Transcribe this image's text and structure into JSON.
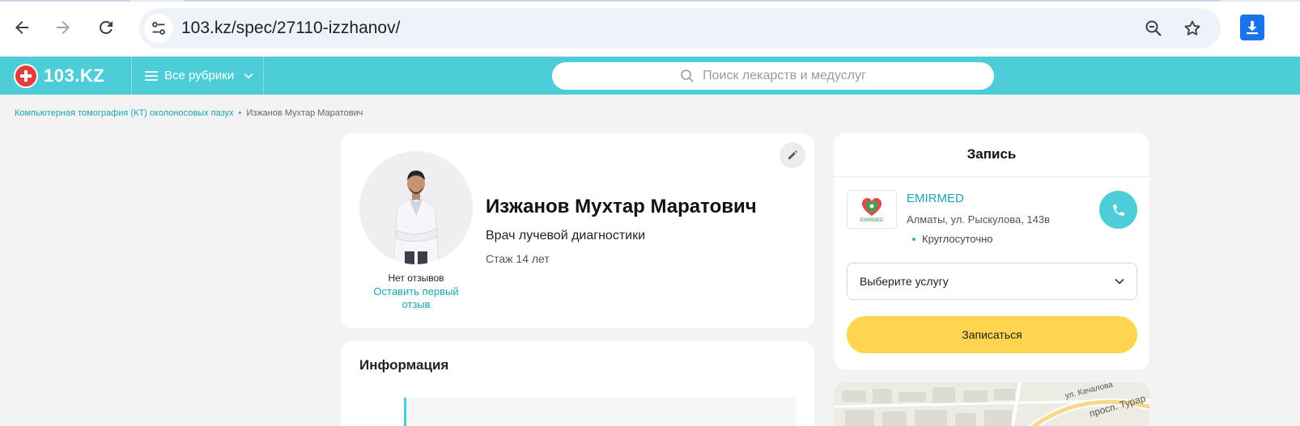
{
  "browser": {
    "url": "103.kz/spec/27110-izzhanov/",
    "icons": {
      "back": "arrow-left-icon",
      "forward": "arrow-right-icon",
      "reload": "reload-icon",
      "site_info": "tune-icon",
      "zoom": "zoom-out-icon",
      "bookmark": "star-icon",
      "download": "download-icon"
    },
    "accent": "#1a73e8"
  },
  "header": {
    "logo_text": "103.KZ",
    "rubrics_label": "Все рубрики",
    "search_placeholder": "Поиск лекарств и медуслуг",
    "color": "#4ccdd7"
  },
  "breadcrumb": {
    "link": "Компьютерная томография (КТ) околоносовых пазух",
    "separator": "•",
    "current": "Изжанов Мухтар Маратович"
  },
  "profile": {
    "name": "Изжанов Мухтар Маратович",
    "specialty": "Врач лучевой диагностики",
    "experience": "Стаж 14 лет",
    "reviews_none": "Нет отзывов",
    "reviews_link": "Оставить первый отзыв"
  },
  "info": {
    "title": "Информация"
  },
  "booking": {
    "title": "Запись",
    "clinic_name": "EMIRMED",
    "clinic_address": "Алматы, ул. Рыскулова, 143в",
    "clinic_hours": "Круглосуточно",
    "service_placeholder": "Выберите услугу",
    "book_label": "Записаться",
    "accent": "#ffd54f"
  },
  "map": {
    "street_1": "ул. Качалова",
    "street_2": "просп. Турар"
  }
}
